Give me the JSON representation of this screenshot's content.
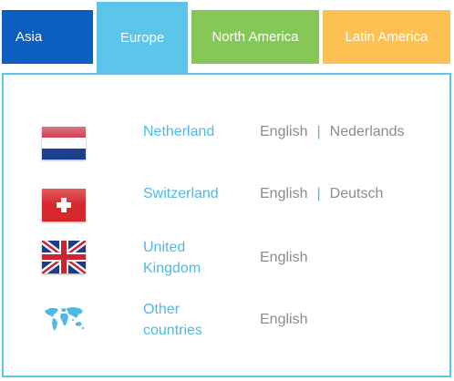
{
  "tabs": [
    {
      "label": "Asia"
    },
    {
      "label": "Europe"
    },
    {
      "label": "North America"
    },
    {
      "label": "Latin America"
    }
  ],
  "colors": {
    "asia": "#0D5FBF",
    "europe": "#5BC5EC",
    "north_america": "#86C75A",
    "latin_america": "#FCC152",
    "link": "#4FB9E6",
    "language_text": "#8c8c8c"
  },
  "separator": "|",
  "countries": [
    {
      "name": "Netherland",
      "flag_icon": "netherlands-flag-icon",
      "languages": [
        "English",
        "Nederlands"
      ]
    },
    {
      "name": "Switzerland",
      "flag_icon": "switzerland-flag-icon",
      "languages": [
        "English",
        "Deutsch"
      ]
    },
    {
      "name_line1": "United",
      "name_line2": "Kingdom",
      "flag_icon": "uk-flag-icon",
      "languages": [
        "English"
      ]
    },
    {
      "name_line1": "Other",
      "name_line2": "countries",
      "flag_icon": "world-map-icon",
      "languages": [
        "English"
      ]
    }
  ]
}
